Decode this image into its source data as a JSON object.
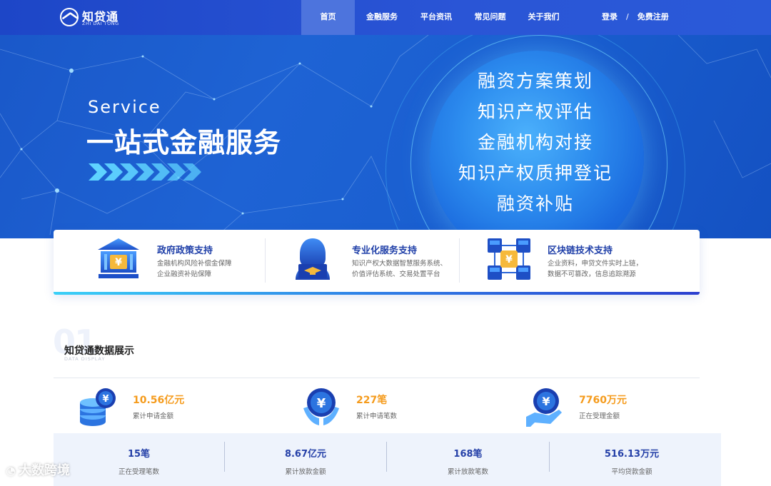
{
  "brand": {
    "name_cn": "知贷通",
    "name_en": "ZHI DAI TONG"
  },
  "nav": {
    "items": [
      {
        "label": "首页"
      },
      {
        "label": "金融服务"
      },
      {
        "label": "平台资讯"
      },
      {
        "label": "常见问题"
      },
      {
        "label": "关于我们"
      }
    ],
    "login": "登录",
    "separator": "/",
    "register": "免费注册"
  },
  "banner": {
    "service_en": "Service",
    "service_cn": "一站式金融服务",
    "services": [
      "融资方案策划",
      "知识产权评估",
      "金融机构对接",
      "知识产权质押登记",
      "融资补贴"
    ]
  },
  "features": [
    {
      "title": "政府政策支持",
      "lines": [
        "金融机构风险补偿金保障",
        "企业融资补贴保障"
      ],
      "icon": "bank-icon"
    },
    {
      "title": "专业化服务支持",
      "lines": [
        "知识产权大数据智慧服务系统、",
        "价值评估系统、交易处置平台"
      ],
      "icon": "graduate-icon"
    },
    {
      "title": "区块链技术支持",
      "lines": [
        "企业资料，申贷文件实时上链，",
        "数据不可篡改，信息追踪溯源"
      ],
      "icon": "blockchain-icon"
    }
  ],
  "section": {
    "number": "01",
    "title": "知贷通数据展示",
    "subtitle": "DATA DISPLAY"
  },
  "stats": [
    {
      "value": "10.56亿元",
      "label": "累计申请金额",
      "icon": "coin-stack-icon"
    },
    {
      "value": "227笔",
      "label": "累计申请笔数",
      "icon": "yuan-hands-icon"
    },
    {
      "value": "7760万元",
      "label": "正在受理金额",
      "icon": "yuan-hand-icon"
    }
  ],
  "bottom_stats": [
    {
      "value": "15笔",
      "label": "正在受理笔数"
    },
    {
      "value": "8.67亿元",
      "label": "累计放款金额"
    },
    {
      "value": "168笔",
      "label": "累计放款笔数"
    },
    {
      "value": "516.13万元",
      "label": "平均贷款金额"
    }
  ],
  "watermark": "大数跨境",
  "colors": {
    "nav": "#2550d3",
    "accent_orange": "#f59b1c",
    "title_blue": "#1f3fa8"
  }
}
